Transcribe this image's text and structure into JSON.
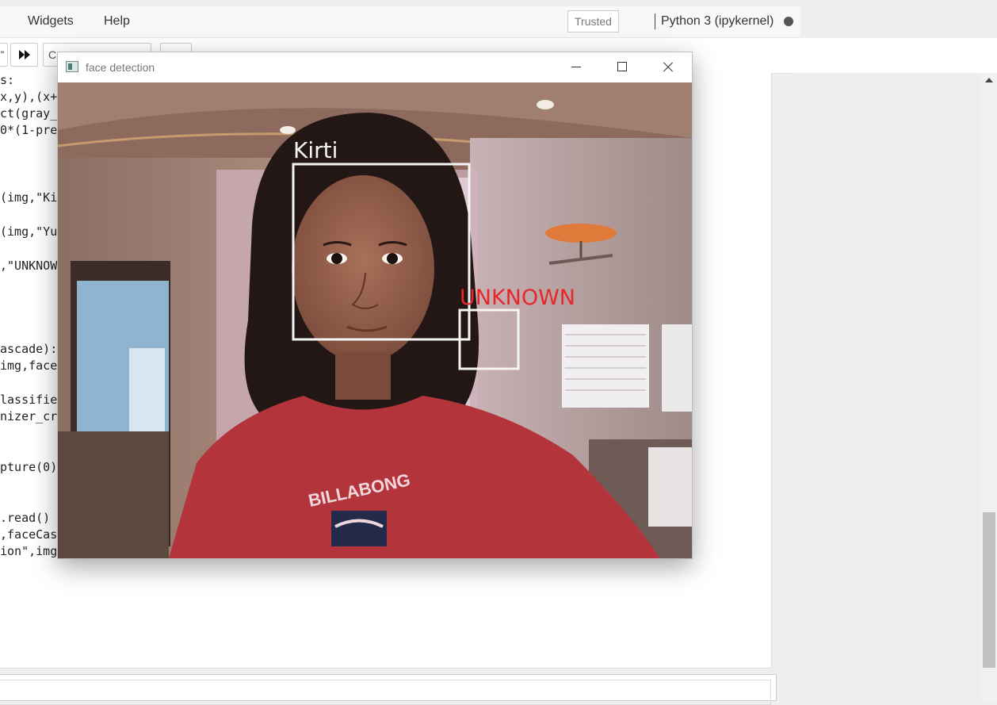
{
  "menubar": {
    "items": [
      "Widgets",
      "Help"
    ],
    "trusted_label": "Trusted",
    "kernel_label": "Python 3 (ipykernel)"
  },
  "toolbar": {
    "run_all_icon": "fast-forward-icon",
    "cell_type_value": "C"
  },
  "code": {
    "lines": [
      "s:",
      "x,y),(x+",
      "ct(gray_",
      "0*(1-pre",
      "(img,\"Ki",
      "(img,\"Yu",
      ",\"UNKNOW",
      "ascade):",
      "img,face",
      "lassifie",
      "nizer_cr",
      "pture(0)",
      ".read()",
      ",faceCas",
      "ion\",img,"
    ]
  },
  "window": {
    "title": "face detection",
    "icon": "opencv-window-icon",
    "controls": [
      "minimize-icon",
      "maximize-icon",
      "close-icon"
    ]
  },
  "detections": [
    {
      "label": "Kirti",
      "color": "#f5f5f5"
    },
    {
      "label": "UNKNOWN",
      "color": "#e8262b"
    }
  ],
  "shirt_text": "BILLABONG"
}
